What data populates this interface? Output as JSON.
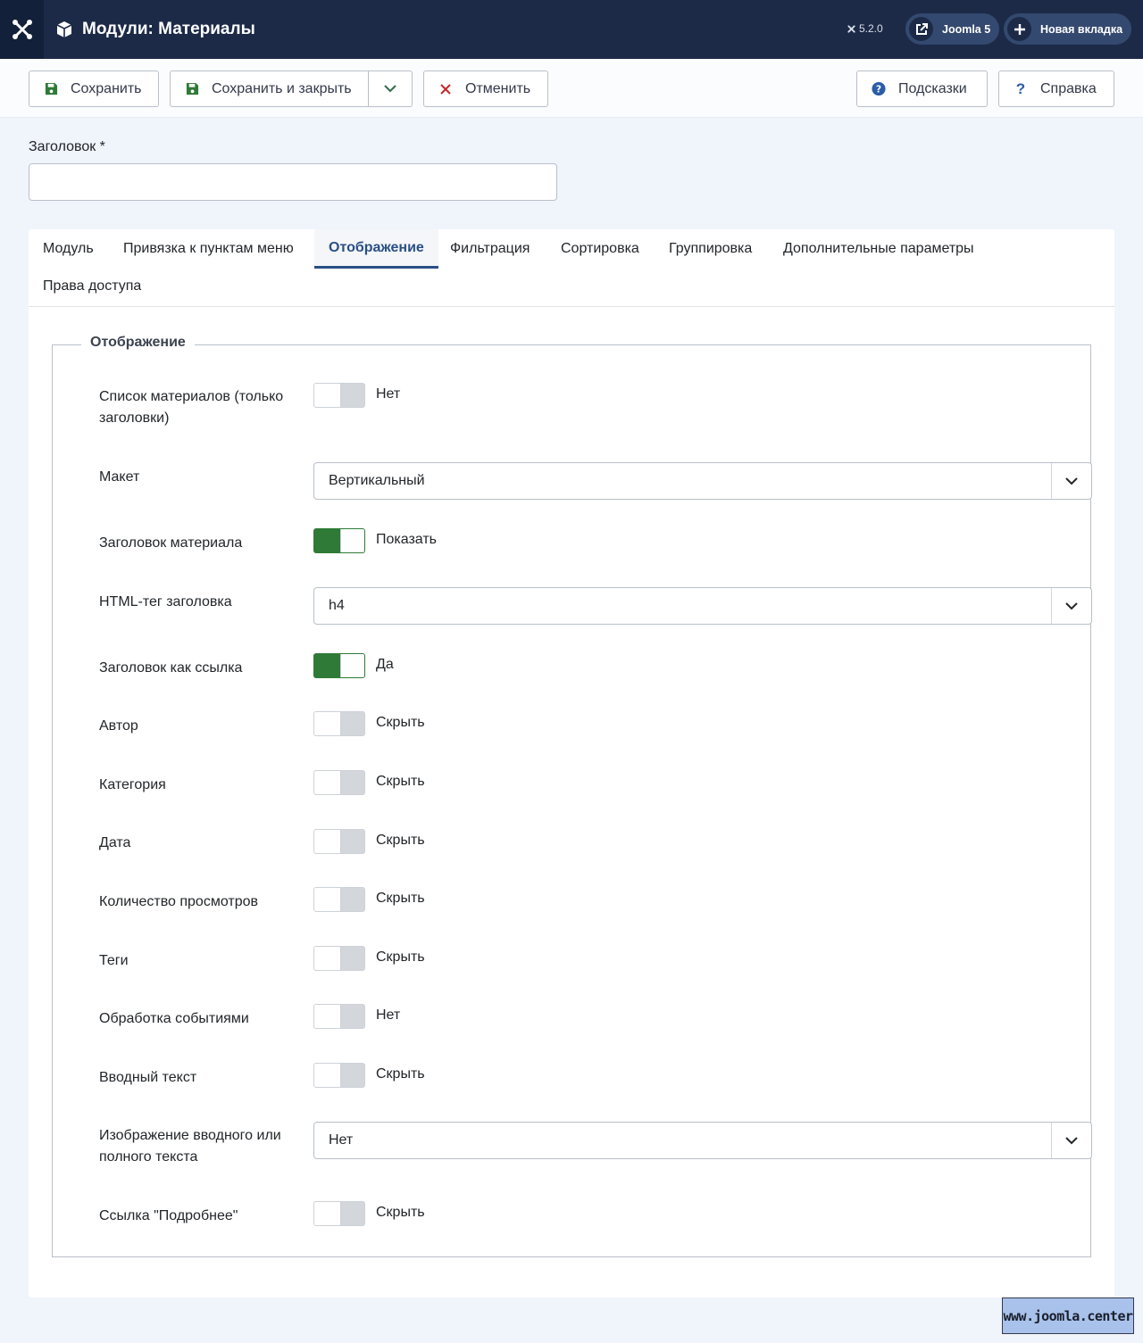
{
  "header": {
    "title": "Модули: Материалы",
    "version": "5.2.0",
    "site_link": "Joomla 5",
    "new_tab": "Новая вкладка"
  },
  "toolbar": {
    "save": "Сохранить",
    "save_close": "Сохранить и закрыть",
    "cancel": "Отменить",
    "tips": "Подсказки",
    "help": "Справка"
  },
  "title_field": {
    "label": "Заголовок *",
    "value": ""
  },
  "tabs": [
    "Модуль",
    "Привязка к пунктам меню",
    "Отображение",
    "Фильтрация",
    "Сортировка",
    "Группировка",
    "Дополнительные параметры",
    "Права доступа"
  ],
  "active_tab": "Отображение",
  "fieldset": {
    "legend": "Отображение",
    "rows": [
      {
        "label": "Список материалов (только заголовки)",
        "type": "switch",
        "on": false,
        "text": "Нет"
      },
      {
        "label": "Макет",
        "type": "select",
        "value": "Вертикальный"
      },
      {
        "label": "Заголовок материала",
        "type": "switch",
        "on": true,
        "text": "Показать"
      },
      {
        "label": "HTML-тег заголовка",
        "type": "select",
        "value": "h4"
      },
      {
        "label": "Заголовок как ссылка",
        "type": "switch",
        "on": true,
        "text": "Да"
      },
      {
        "label": "Автор",
        "type": "switch",
        "on": false,
        "text": "Скрыть"
      },
      {
        "label": "Категория",
        "type": "switch",
        "on": false,
        "text": "Скрыть"
      },
      {
        "label": "Дата",
        "type": "switch",
        "on": false,
        "text": "Скрыть"
      },
      {
        "label": "Количество просмотров",
        "type": "switch",
        "on": false,
        "text": "Скрыть"
      },
      {
        "label": "Теги",
        "type": "switch",
        "on": false,
        "text": "Скрыть"
      },
      {
        "label": "Обработка событиями",
        "type": "switch",
        "on": false,
        "text": "Нет"
      },
      {
        "label": "Вводный текст",
        "type": "switch",
        "on": false,
        "text": "Скрыть"
      },
      {
        "label": "Изображение вводного или полного текста",
        "type": "select",
        "value": "Нет"
      },
      {
        "label": "Ссылка \"Подробнее\"",
        "type": "switch",
        "on": false,
        "text": "Скрыть"
      }
    ]
  },
  "watermark": "www.joomla.center",
  "colors": {
    "header": "#1c2a48",
    "accent": "#2a4f86",
    "switch_on": "#2e7a36"
  }
}
